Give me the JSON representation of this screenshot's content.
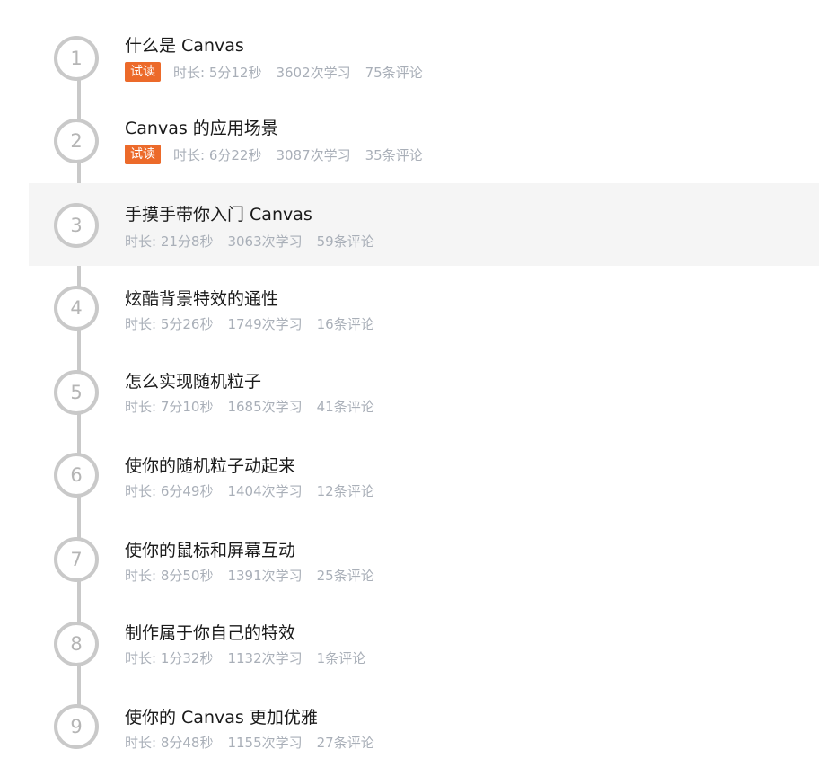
{
  "trial_label": "试读",
  "colors": {
    "badge_bg": "#ec6a2a",
    "timeline": "#c9c9c9",
    "active_row_bg": "#f5f5f5",
    "meta_text": "#a9afb8"
  },
  "lessons": [
    {
      "number": "1",
      "title": "什么是 Canvas",
      "trial": true,
      "duration": "时长: 5分12秒",
      "learners": "3602次学习",
      "comments": "75条评论"
    },
    {
      "number": "2",
      "title": "Canvas 的应用场景",
      "trial": true,
      "duration": "时长: 6分22秒",
      "learners": "3087次学习",
      "comments": "35条评论"
    },
    {
      "number": "3",
      "title": "手摸手带你入门 Canvas",
      "trial": false,
      "duration": "时长: 21分8秒",
      "learners": "3063次学习",
      "comments": "59条评论"
    },
    {
      "number": "4",
      "title": "炫酷背景特效的通性",
      "trial": false,
      "duration": "时长: 5分26秒",
      "learners": "1749次学习",
      "comments": "16条评论"
    },
    {
      "number": "5",
      "title": "怎么实现随机粒子",
      "trial": false,
      "duration": "时长: 7分10秒",
      "learners": "1685次学习",
      "comments": "41条评论"
    },
    {
      "number": "6",
      "title": "使你的随机粒子动起来",
      "trial": false,
      "duration": "时长: 6分49秒",
      "learners": "1404次学习",
      "comments": "12条评论"
    },
    {
      "number": "7",
      "title": "使你的鼠标和屏幕互动",
      "trial": false,
      "duration": "时长: 8分50秒",
      "learners": "1391次学习",
      "comments": "25条评论"
    },
    {
      "number": "8",
      "title": "制作属于你自己的特效",
      "trial": false,
      "duration": "时长: 1分32秒",
      "learners": "1132次学习",
      "comments": "1条评论"
    },
    {
      "number": "9",
      "title": "使你的 Canvas 更加优雅",
      "trial": false,
      "duration": "时长: 8分48秒",
      "learners": "1155次学习",
      "comments": "27条评论"
    }
  ]
}
